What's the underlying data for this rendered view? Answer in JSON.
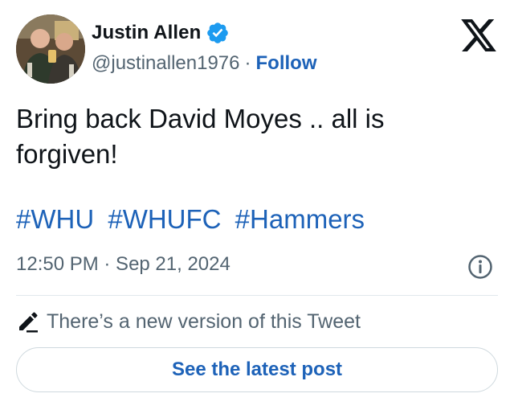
{
  "author": {
    "display_name": "Justin Allen",
    "handle": "@justinallen1976",
    "separator": "·",
    "follow_label": "Follow",
    "verified": true
  },
  "tweet": {
    "text": "Bring back David Moyes .. all is forgiven!",
    "hashtags": [
      "#WHU",
      "#WHUFC",
      "#Hammers"
    ],
    "timestamp": "12:50 PM · Sep 21, 2024"
  },
  "edit_notice": {
    "text": "There’s a new version of this Tweet",
    "button_label": "See the latest post"
  },
  "icons": {
    "verified": "verified-badge-icon",
    "brand": "x-logo-icon",
    "info": "info-icon",
    "edit": "pencil-icon"
  },
  "colors": {
    "link": "#1d62b8",
    "verified": "#1d9bf0",
    "muted": "#536471",
    "text": "#0f1419"
  }
}
